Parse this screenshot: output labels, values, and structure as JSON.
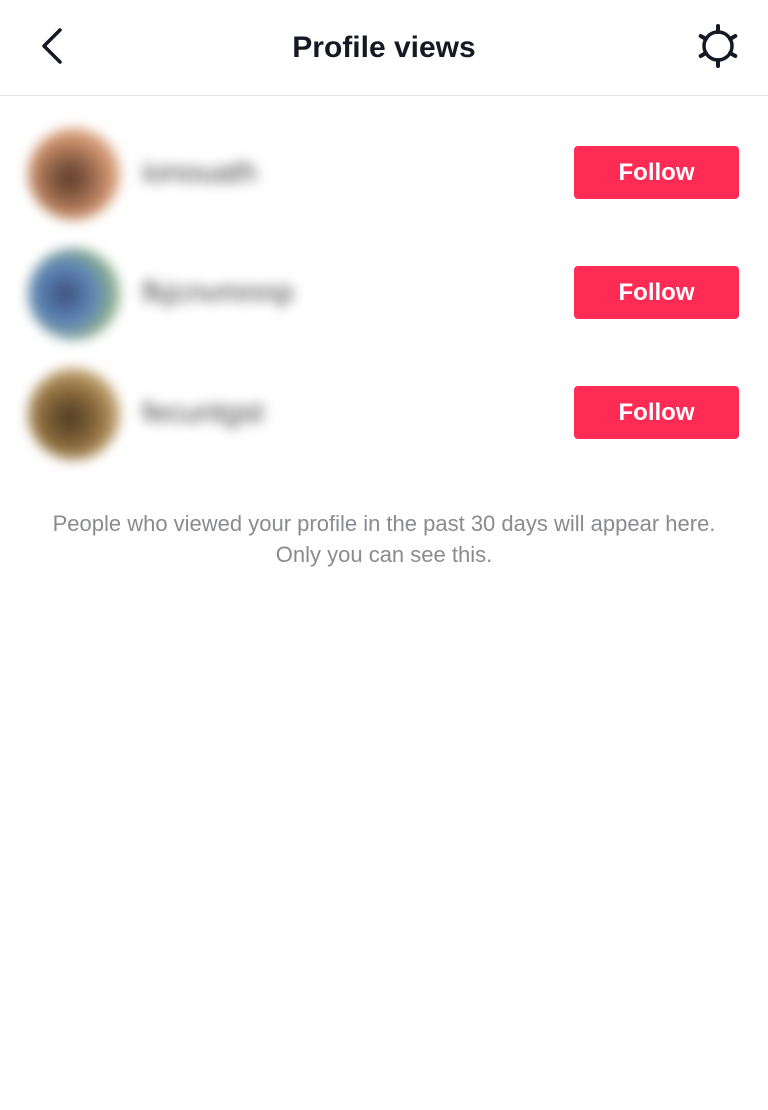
{
  "header": {
    "title": "Profile views",
    "back_icon": "chevron-left-icon",
    "settings_icon": "gear-icon"
  },
  "viewers": [
    {
      "username": "ionouath",
      "follow_label": "Follow"
    },
    {
      "username": "fkjcnvmnnp",
      "follow_label": "Follow"
    },
    {
      "username": "fecuntgst",
      "follow_label": "Follow"
    }
  ],
  "info_text": "People who viewed your profile in the past 30 days will appear here. Only you can see this.",
  "colors": {
    "accent": "#fe2c55",
    "muted_text": "#8a8b91"
  }
}
